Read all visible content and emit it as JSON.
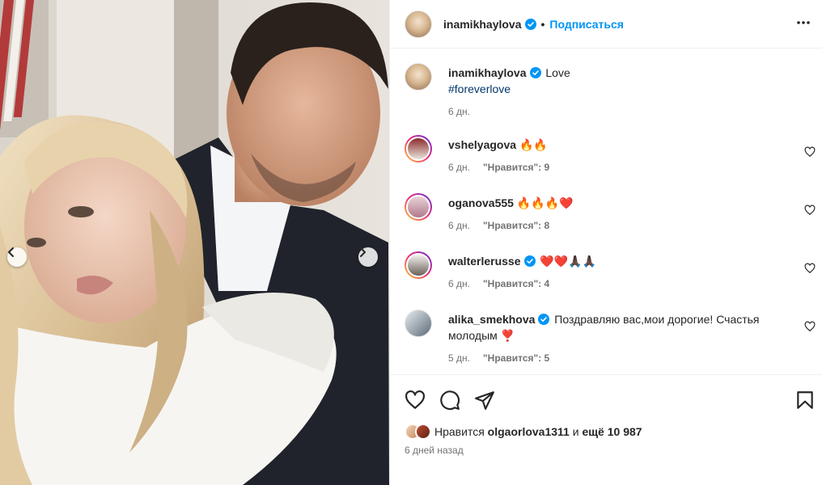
{
  "header": {
    "username": "inamikhaylova",
    "separator": "•",
    "follow_label": "Подписаться"
  },
  "caption": {
    "username": "inamikhaylova",
    "text": "Love",
    "hashtag": "#foreverlove",
    "time": "6 дн."
  },
  "comments": [
    {
      "username": "vshelyagova",
      "verified": false,
      "text": "🔥🔥",
      "time": "6 дн.",
      "likes": "\"Нравится\": 9"
    },
    {
      "username": "oganova555",
      "verified": false,
      "text": "🔥🔥🔥❤️",
      "time": "6 дн.",
      "likes": "\"Нравится\": 8"
    },
    {
      "username": "walterlerusse",
      "verified": true,
      "text": "❤️❤️🙏🏿🙏🏿",
      "time": "6 дн.",
      "likes": "\"Нравится\": 4"
    },
    {
      "username": "alika_smekhova",
      "verified": true,
      "text": "Поздравляю вас,мои дорогие! Счастья молодым ❣️",
      "time": "5 дн.",
      "likes": "\"Нравится\": 5"
    }
  ],
  "likes": {
    "prefix": "Нравится",
    "user": "olgaorlova1311",
    "joiner": "и",
    "rest": "ещё 10 987"
  },
  "post_time": "6 дней назад",
  "icons": {
    "verified": "verified-badge-icon",
    "more": "more-options-icon",
    "like": "heart-icon",
    "comment": "comment-icon",
    "share": "share-icon",
    "save": "bookmark-icon"
  },
  "colors": {
    "accent": "#0095f6",
    "verified": "#0095f6",
    "hashtag": "#00376b",
    "muted": "#737373"
  }
}
